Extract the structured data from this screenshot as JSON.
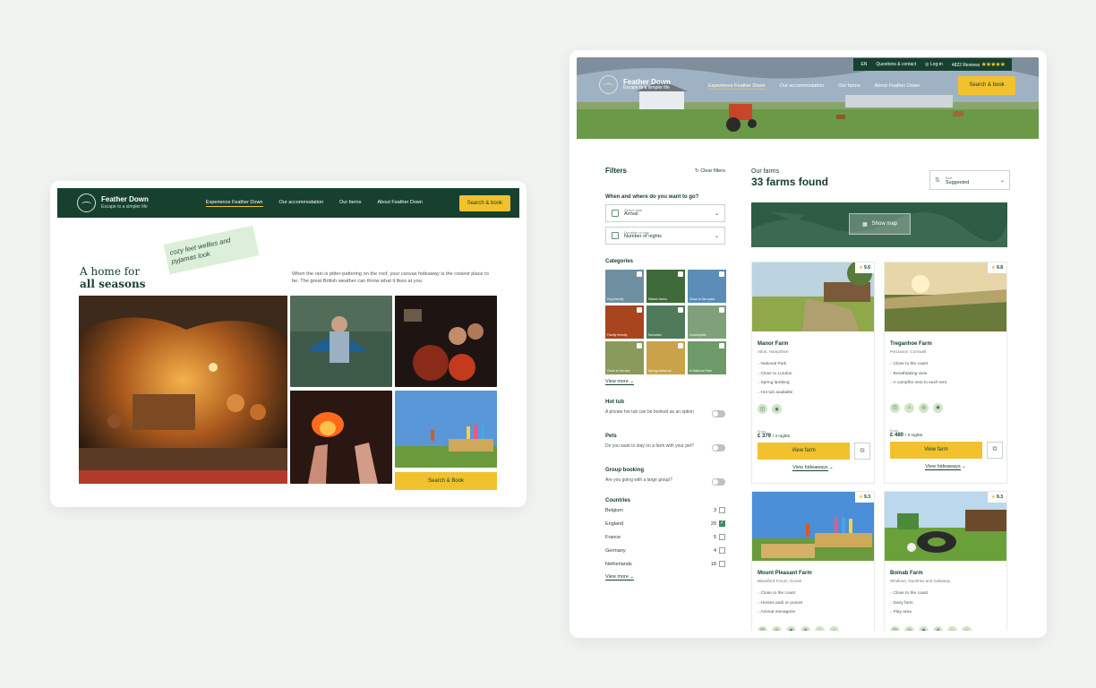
{
  "left": {
    "brand": {
      "name": "Feather Down",
      "tagline": "Escape to a simpler life"
    },
    "nav": [
      "Experience Feather Down",
      "Our accommodation",
      "Our farms",
      "About Feather Down"
    ],
    "book_label": "Search & book",
    "title_line1": "A home for",
    "title_line2": "all seasons",
    "note": "cozy feet wellies and pyjamas look",
    "lead": "When the rain is pitter-pattering on the roof, your canvas hideaway is the cosiest place to be. The great British weather can throw what it likes at you.",
    "tile_button": "Search & Book"
  },
  "right": {
    "topbar": {
      "lang": "EN",
      "questions": "Questions & contact",
      "login": "Log-in",
      "reviews": "4822 Reviews",
      "stars": "★★★★★"
    },
    "brand": {
      "name": "Feather Down",
      "tagline": "Escape to a simpler life"
    },
    "nav": [
      "Experience Feather Down",
      "Our accommodation",
      "Our farms",
      "About Feather Down"
    ],
    "book_label": "Search & book",
    "filters": {
      "title": "Filters",
      "clear": "Clear filters",
      "when_where": "When and where do you want to go?",
      "arrival_small": "Select date",
      "arrival": "Arrival",
      "nights_small": "Duration of stay",
      "nights": "Number of nights",
      "categories_title": "Categories",
      "categories": [
        "Dog friendly",
        "Hidden farms",
        "Close to the coast",
        "Family friendly",
        "Secluded",
        "Countryside",
        "Close to the sea",
        "Spring barbecue",
        "In National Park"
      ],
      "view_more": "View more",
      "hot_tub": {
        "title": "Hot tub",
        "desc": "A private hot tub can be booked as an option"
      },
      "pets": {
        "title": "Pets",
        "desc": "Do you want to stay on a farm with your pet?"
      },
      "group": {
        "title": "Group booking",
        "desc": "Are you going with a large group?"
      },
      "countries_title": "Countries",
      "countries": [
        {
          "name": "Belgium",
          "count": "3",
          "checked": false
        },
        {
          "name": "England",
          "count": "29",
          "checked": true
        },
        {
          "name": "France",
          "count": "5",
          "checked": false
        },
        {
          "name": "Germany",
          "count": "4",
          "checked": false
        },
        {
          "name": "Netherlands",
          "count": "18",
          "checked": false
        }
      ],
      "view_more2": "View more"
    },
    "results": {
      "subtitle": "Our farms",
      "count": "33 farms found",
      "sort_small": "Sort",
      "sort_value": "Suggested",
      "map_label": "Show map",
      "cards": [
        {
          "name": "Manor Farm",
          "loc": "Alton, Hampshire",
          "score": "9.6",
          "features": [
            "National Park",
            "Close to London",
            "Spring lambing",
            "Hot tub available"
          ],
          "from": "From",
          "price": "£ 379",
          "per": "/ 4 nights",
          "view": "View farm",
          "hideaways": "View hideaways"
        },
        {
          "name": "Treganhoe Farm",
          "loc": "Penzance, Cornwall",
          "score": "9.8",
          "features": [
            "Close to the coast",
            "Breathtaking view",
            "A campfire next to each tent"
          ],
          "from": "From",
          "price": "£ 480",
          "per": "/ 3 nights",
          "view": "View farm",
          "hideaways": "View hideaways"
        },
        {
          "name": "Mount Pleasant Farm",
          "loc": "Blandford Forum, Dorset",
          "score": "9.3",
          "features": [
            "Close to the coast",
            "Horses and/ or ponies",
            "Animal menagerie"
          ]
        },
        {
          "name": "Boinab Farm",
          "loc": "Whithorn, Dumfries and Galloway",
          "score": "9.3",
          "features": [
            "Close to the coast",
            "Dairy farm",
            "Play area"
          ]
        }
      ]
    }
  }
}
